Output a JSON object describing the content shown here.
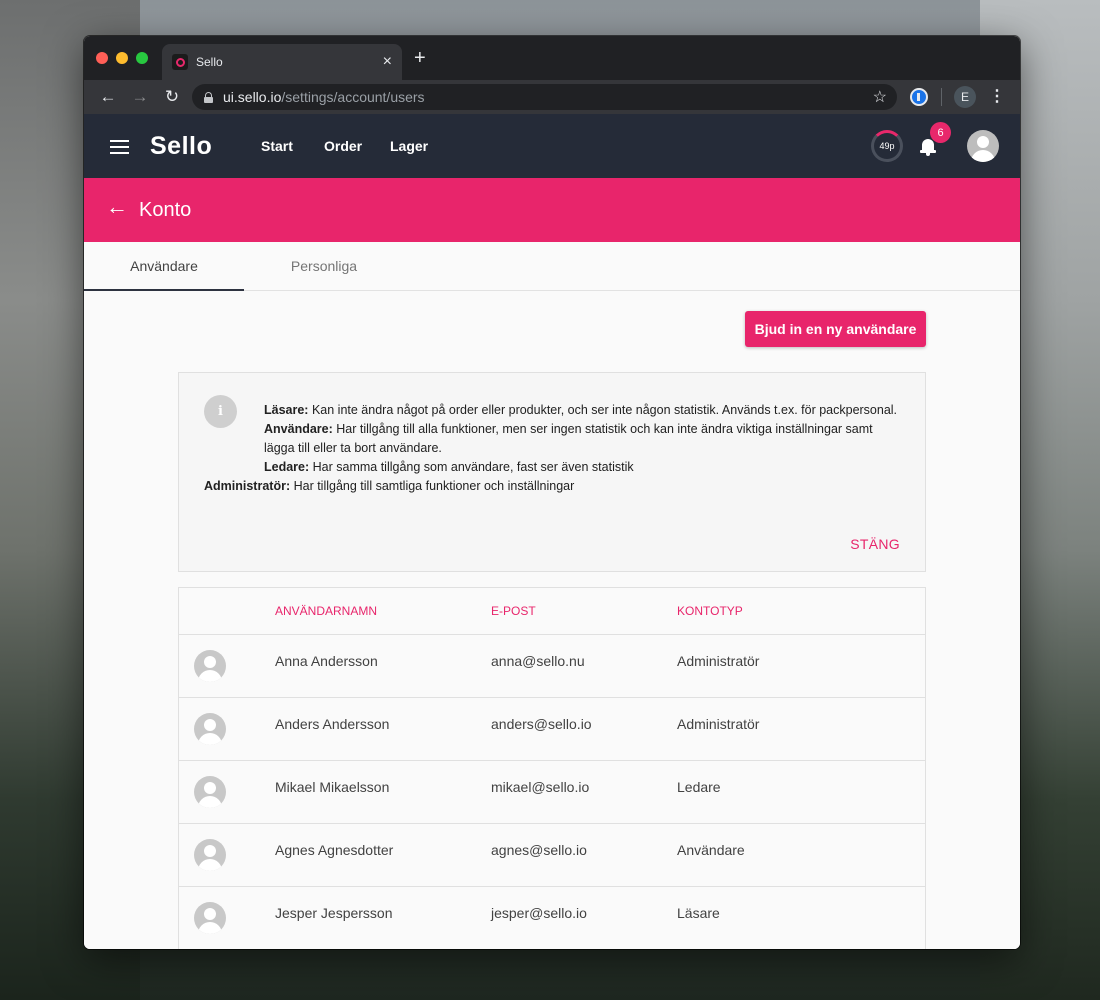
{
  "browser": {
    "tab_title": "Sello",
    "tab_close": "×",
    "new_tab": "+",
    "url_host": "ui.sello.io",
    "url_path": "/settings/account/users",
    "profile_initial": "E"
  },
  "app": {
    "brand": "Sello",
    "nav": [
      "Start",
      "Order",
      "Lager"
    ],
    "credits": "49p",
    "notification_count": "6"
  },
  "page": {
    "title": "Konto",
    "tabs": [
      {
        "label": "Användare",
        "active": true
      },
      {
        "label": "Personliga",
        "active": false
      }
    ],
    "invite_button": "Bjud in en ny användare"
  },
  "info": {
    "icon": "i",
    "roles": [
      {
        "name": "Läsare:",
        "desc": " Kan inte ändra något på order eller produkter, och ser inte någon statistik. Används t.ex. för packpersonal."
      },
      {
        "name": "Användare:",
        "desc": " Har tillgång till alla funktioner, men ser ingen statistik och kan inte ändra viktiga inställningar samt lägga till eller ta bort användare."
      },
      {
        "name": "Ledare:",
        "desc": " Har samma tillgång som användare, fast ser även statistik"
      },
      {
        "name": "Administratör:",
        "desc": " Har tillgång till samtliga funktioner och inställningar"
      }
    ],
    "close_label": "STÄNG"
  },
  "table": {
    "columns": [
      "ANVÄNDARNAMN",
      "E-POST",
      "KONTOTYP"
    ],
    "rows": [
      {
        "name": "Anna Andersson",
        "email": "anna@sello.nu",
        "type": "Administratör"
      },
      {
        "name": "Anders Andersson",
        "email": "anders@sello.io",
        "type": "Administratör"
      },
      {
        "name": "Mikael Mikaelsson",
        "email": "mikael@sello.io",
        "type": "Ledare"
      },
      {
        "name": "Agnes Agnesdotter",
        "email": "agnes@sello.io",
        "type": "Användare"
      },
      {
        "name": "Jesper Jespersson",
        "email": "jesper@sello.io",
        "type": "Läsare"
      }
    ]
  },
  "colors": {
    "accent": "#e8256b",
    "header_bg": "#252b38",
    "chrome_bg": "#202124"
  }
}
